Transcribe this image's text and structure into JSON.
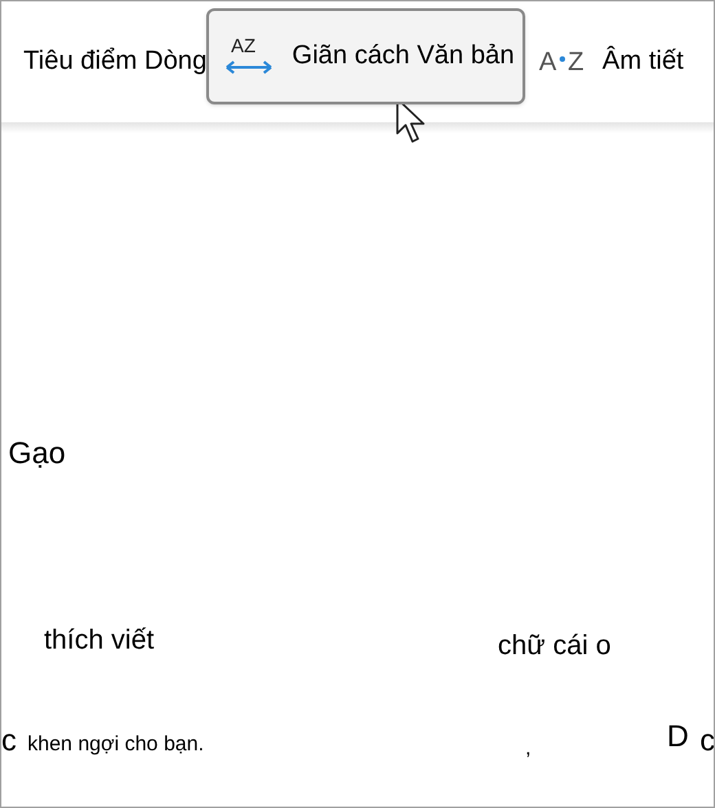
{
  "toolbar": {
    "items": [
      {
        "kind": "text",
        "label": "Tiêu điểm Dòng",
        "hovered": false
      },
      {
        "kind": "spacing",
        "label": "Giãn cách Văn bản",
        "hovered": true,
        "icon_text": "AZ"
      },
      {
        "kind": "syllables",
        "label": "Âm tiết",
        "hovered": false,
        "icon_letters": [
          "A",
          "Z"
        ]
      }
    ]
  },
  "content": {
    "fragments": [
      {
        "text": "Gạo"
      },
      {
        "text": "thích viết"
      },
      {
        "text": "chữ cái o"
      },
      {
        "text": "c"
      },
      {
        "text": "khen ngợi cho bạn."
      },
      {
        "text": ","
      },
      {
        "text": "D"
      },
      {
        "text": "c"
      }
    ]
  }
}
